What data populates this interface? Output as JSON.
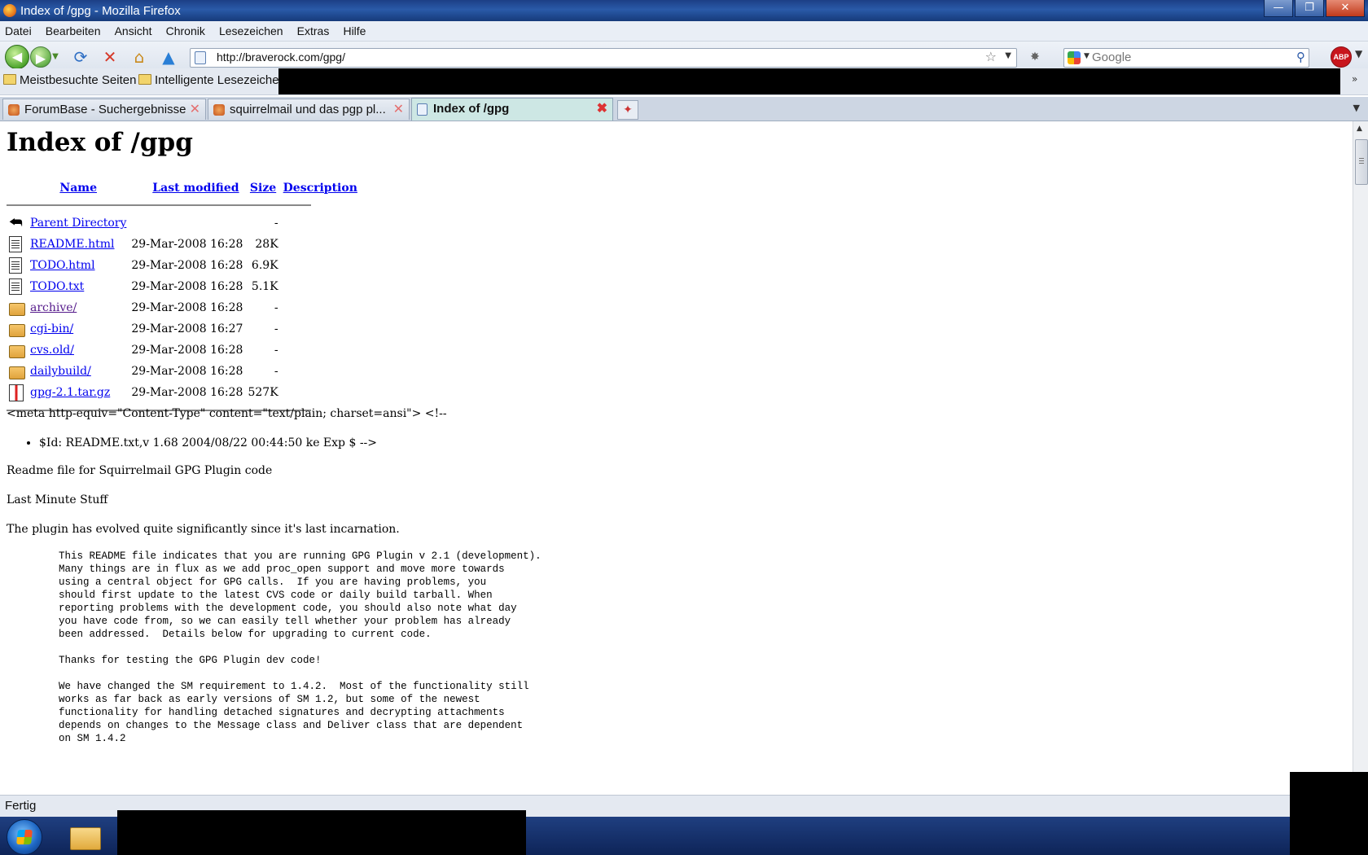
{
  "window": {
    "title": "Index of /gpg - Mozilla Firefox"
  },
  "menu": [
    "Datei",
    "Bearbeiten",
    "Ansicht",
    "Chronik",
    "Lesezeichen",
    "Extras",
    "Hilfe"
  ],
  "nav": {
    "url": "http://braverock.com/gpg/",
    "search_placeholder": "Google",
    "adblock_label": "ABP"
  },
  "bookmarks": [
    {
      "label": "Meistbesuchte Seiten",
      "icon": "folder-star-icon"
    },
    {
      "label": "Intelligente Lesezeiche",
      "icon": "folder-icon"
    }
  ],
  "tabs": [
    {
      "label": "ForumBase - Suchergebnisse",
      "active": false
    },
    {
      "label": "squirrelmail und das pgp pl...",
      "active": false
    },
    {
      "label": "Index of /gpg",
      "active": true
    }
  ],
  "page": {
    "heading": "Index of /gpg",
    "columns": {
      "name": "Name",
      "modified": "Last modified",
      "size": "Size",
      "description": "Description"
    },
    "parent": {
      "name": "Parent Directory",
      "size": "-"
    },
    "files": [
      {
        "name": "README.html",
        "modified": "29-Mar-2008 16:28",
        "size": "28K",
        "icon": "text-file-icon"
      },
      {
        "name": "TODO.html",
        "modified": "29-Mar-2008 16:28",
        "size": "6.9K",
        "icon": "text-file-icon"
      },
      {
        "name": "TODO.txt",
        "modified": "29-Mar-2008 16:28",
        "size": "5.1K",
        "icon": "text-file-icon"
      },
      {
        "name": "archive/",
        "modified": "29-Mar-2008 16:28",
        "size": "-",
        "icon": "folder-icon"
      },
      {
        "name": "cgi-bin/",
        "modified": "29-Mar-2008 16:27",
        "size": "-",
        "icon": "folder-icon"
      },
      {
        "name": "cvs.old/",
        "modified": "29-Mar-2008 16:28",
        "size": "-",
        "icon": "folder-icon"
      },
      {
        "name": "dailybuild/",
        "modified": "29-Mar-2008 16:28",
        "size": "-",
        "icon": "folder-icon"
      },
      {
        "name": "gpg-2.1.tar.gz",
        "modified": "29-Mar-2008 16:28",
        "size": "527K",
        "icon": "archive-file-icon"
      }
    ],
    "readme": {
      "meta_line": "<meta http-equiv=\"Content-Type\" content=\"text/plain; charset=ansi\"> <!--",
      "bullet": "$Id: README.txt,v 1.68 2004/08/22 00:44:50 ke Exp $ -->",
      "p1": "Readme file for Squirrelmail GPG Plugin code",
      "p2": "Last Minute Stuff",
      "p3": "The plugin has evolved quite significantly since it's last incarnation.",
      "pre": "This README file indicates that you are running GPG Plugin v 2.1 (development).\nMany things are in flux as we add proc_open support and move more towards\nusing a central object for GPG calls.  If you are having problems, you\nshould first update to the latest CVS code or daily build tarball. When\nreporting problems with the development code, you should also note what day\nyou have code from, so we can easily tell whether your problem has already\nbeen addressed.  Details below for upgrading to current code.\n\nThanks for testing the GPG Plugin dev code!\n\nWe have changed the SM requirement to 1.4.2.  Most of the functionality still\nworks as far back as early versions of SM 1.2, but some of the newest\nfunctionality for handling detached signatures and decrypting attachments\ndepends on changes to the Message class and Deliver class that are dependent\non SM 1.4.2"
    }
  },
  "status": {
    "text": "Fertig"
  }
}
